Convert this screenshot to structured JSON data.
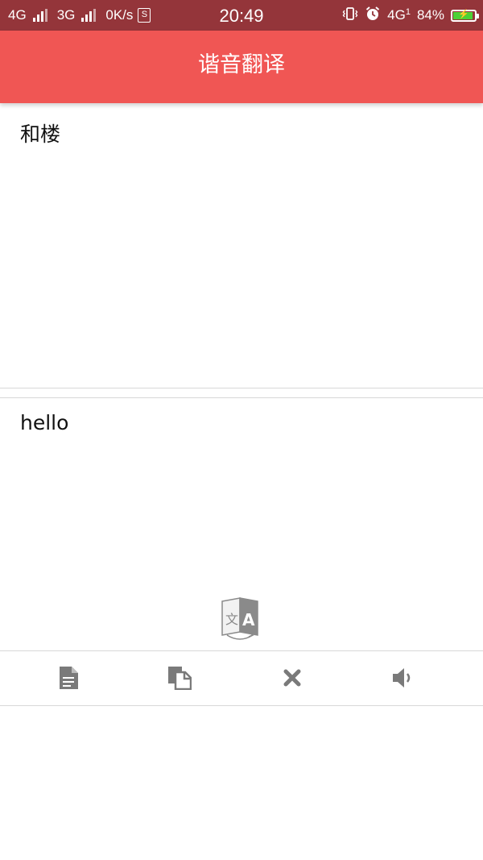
{
  "status_bar": {
    "net1": "4G",
    "net2": "3G",
    "speed": "0K/s",
    "s_badge": "S",
    "time": "20:49",
    "net3": "4G",
    "net3_sub": "1",
    "battery": "84%",
    "icons": [
      "signal-icon",
      "signal-icon",
      "app-s-icon",
      "vibrate-icon",
      "alarm-icon",
      "battery-charging-icon"
    ]
  },
  "app_bar": {
    "title": "谐音翻译"
  },
  "input": {
    "value": "和楼"
  },
  "output": {
    "value": "hello"
  },
  "actions": {
    "translate_icon": "translate-icon",
    "tools": [
      {
        "name": "document-icon"
      },
      {
        "name": "copy-icon"
      },
      {
        "name": "clear-icon"
      },
      {
        "name": "speaker-icon"
      }
    ]
  },
  "colors": {
    "status_bar": "#94353a",
    "app_bar": "#f05654",
    "icon_gray": "#7a7a7a",
    "divider": "#d8d8d8"
  }
}
